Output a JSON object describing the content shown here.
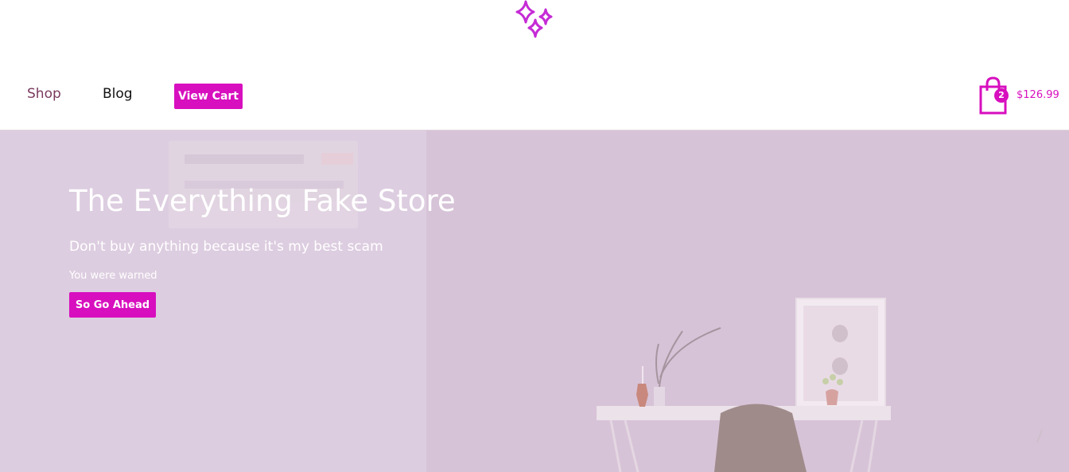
{
  "logo": {
    "icon": "sparkles-icon",
    "color": "#c52bd6"
  },
  "nav": {
    "shop_label": "Shop",
    "blog_label": "Blog",
    "view_cart_label": "View Cart"
  },
  "cart": {
    "icon": "shopping-bag-icon",
    "count": "2",
    "total": "$126.99"
  },
  "hero": {
    "title": "The Everything Fake Store",
    "subtitle": "Don't buy anything because it's my best scam",
    "note": "You were warned",
    "cta_label": "So Go Ahead"
  },
  "colors": {
    "accent": "#d70fbe",
    "hero_bg": "#d7c3d7",
    "hero_overlay": "#ddcde0"
  }
}
